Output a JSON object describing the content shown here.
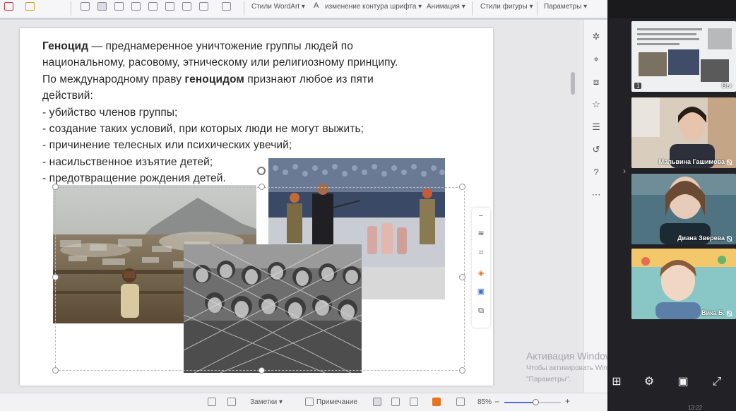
{
  "ribbon": {
    "wordart_label": "Стили WordArt ▾",
    "font_outline_label": "изменение контура шрифта ▾",
    "animation_label": "Анимация ▾",
    "shape_styles_label": "Стили фигуры ▾",
    "params_label": "Параметры ▾"
  },
  "slide": {
    "lines": [
      {
        "bold": "Геноцид",
        "rest": " — преднамеренное уничтожение группы людей по"
      },
      {
        "text": "национальному, расовому, этническому или религиозному принципу."
      },
      {
        "pre": "По международному праву ",
        "bold": "геноцидом",
        "post": " признают любое из пяти"
      },
      {
        "text": "действий:"
      },
      {
        "text": "- убийство членов группы;"
      },
      {
        "text": " - создание таких условий, при которых люди не могут выжить;"
      },
      {
        "text": " - причинение телесных или психических увечий;"
      },
      {
        "text": " - насильственное изъятие детей;"
      },
      {
        "text": " - предотвращение рождения детей."
      }
    ]
  },
  "statusbar": {
    "notes_label": "Заметки ▾",
    "comment_label": "Примечание",
    "zoom_value": "85%",
    "zoom_level": 0.55
  },
  "watermark": {
    "title": "Активация Windows",
    "line1": "Чтобы активировать Windows, перейдите в раздел",
    "line2": "\"Параметры\"."
  },
  "meeting": {
    "tiles": [
      {
        "name": "Вы",
        "index": "1",
        "muted": false
      },
      {
        "name": "Мальвина Гашимова",
        "muted": true
      },
      {
        "name": "Диана Зверева",
        "muted": true
      },
      {
        "name": "Вика Б.",
        "muted": true
      }
    ],
    "clock": "13:22"
  },
  "colors": {
    "slide_bg": "#ffffff",
    "meeting_bg": "#222226",
    "accent_orange": "#e8731f"
  }
}
